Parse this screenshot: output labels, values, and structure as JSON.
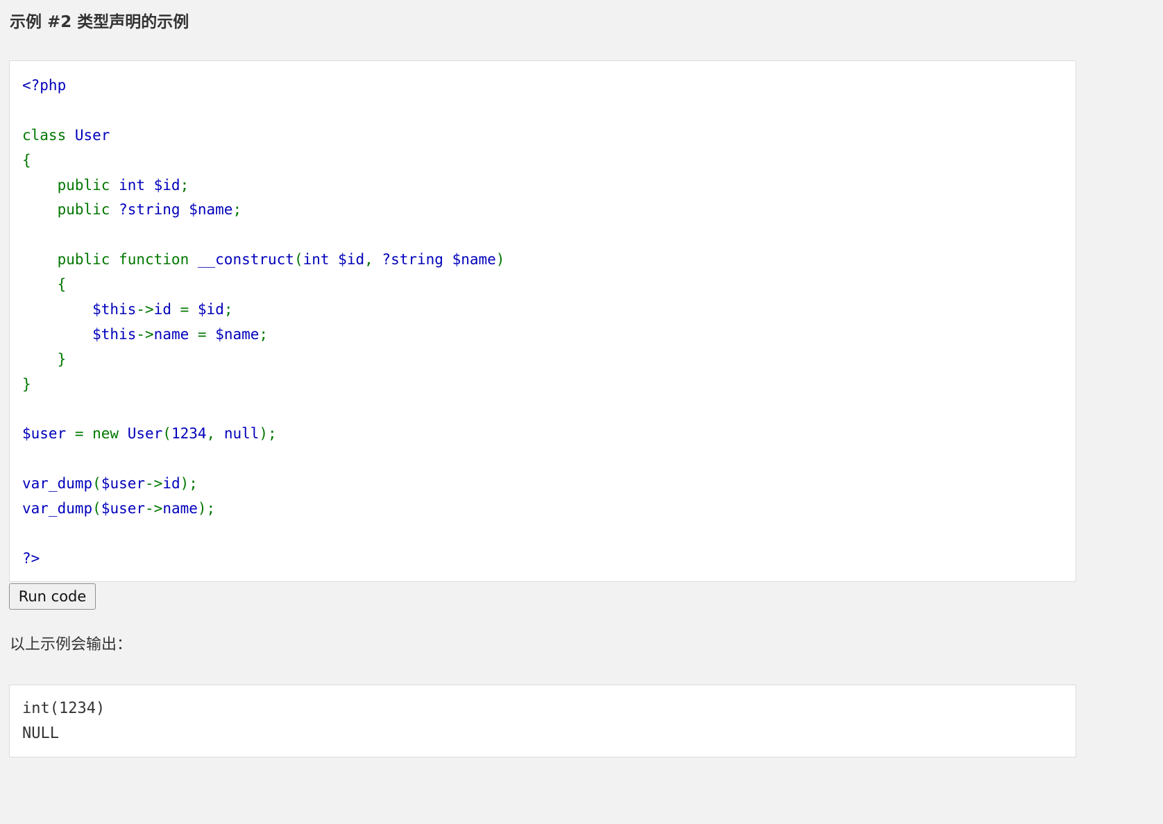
{
  "example": {
    "title": "示例 #2 类型声明的示例"
  },
  "code": {
    "lines": [
      [
        {
          "t": "<?php",
          "c": "d"
        }
      ],
      [],
      [
        {
          "t": "class ",
          "c": "k"
        },
        {
          "t": "User",
          "c": "d"
        }
      ],
      [
        {
          "t": "{",
          "c": "k"
        }
      ],
      [
        {
          "t": "    public ",
          "c": "k"
        },
        {
          "t": "int $id",
          "c": "d"
        },
        {
          "t": ";",
          "c": "k"
        }
      ],
      [
        {
          "t": "    public ",
          "c": "k"
        },
        {
          "t": "?string $name",
          "c": "d"
        },
        {
          "t": ";",
          "c": "k"
        }
      ],
      [],
      [
        {
          "t": "    public function ",
          "c": "k"
        },
        {
          "t": "__construct",
          "c": "d"
        },
        {
          "t": "(",
          "c": "k"
        },
        {
          "t": "int $id",
          "c": "d"
        },
        {
          "t": ", ",
          "c": "k"
        },
        {
          "t": "?string $name",
          "c": "d"
        },
        {
          "t": ")",
          "c": "k"
        }
      ],
      [
        {
          "t": "    {",
          "c": "k"
        }
      ],
      [
        {
          "t": "        $this",
          "c": "d"
        },
        {
          "t": "->",
          "c": "k"
        },
        {
          "t": "id ",
          "c": "d"
        },
        {
          "t": "= ",
          "c": "k"
        },
        {
          "t": "$id",
          "c": "d"
        },
        {
          "t": ";",
          "c": "k"
        }
      ],
      [
        {
          "t": "        $this",
          "c": "d"
        },
        {
          "t": "->",
          "c": "k"
        },
        {
          "t": "name ",
          "c": "d"
        },
        {
          "t": "= ",
          "c": "k"
        },
        {
          "t": "$name",
          "c": "d"
        },
        {
          "t": ";",
          "c": "k"
        }
      ],
      [
        {
          "t": "    }",
          "c": "k"
        }
      ],
      [
        {
          "t": "}",
          "c": "k"
        }
      ],
      [],
      [
        {
          "t": "$user ",
          "c": "d"
        },
        {
          "t": "= new ",
          "c": "k"
        },
        {
          "t": "User",
          "c": "d"
        },
        {
          "t": "(",
          "c": "k"
        },
        {
          "t": "1234",
          "c": "d"
        },
        {
          "t": ", ",
          "c": "k"
        },
        {
          "t": "null",
          "c": "d"
        },
        {
          "t": ");",
          "c": "k"
        }
      ],
      [],
      [
        {
          "t": "var_dump",
          "c": "d"
        },
        {
          "t": "(",
          "c": "k"
        },
        {
          "t": "$user",
          "c": "d"
        },
        {
          "t": "->",
          "c": "k"
        },
        {
          "t": "id",
          "c": "d"
        },
        {
          "t": ");",
          "c": "k"
        }
      ],
      [
        {
          "t": "var_dump",
          "c": "d"
        },
        {
          "t": "(",
          "c": "k"
        },
        {
          "t": "$user",
          "c": "d"
        },
        {
          "t": "->",
          "c": "k"
        },
        {
          "t": "name",
          "c": "d"
        },
        {
          "t": ");",
          "c": "k"
        }
      ],
      [],
      [
        {
          "t": "?>",
          "c": "d"
        }
      ]
    ]
  },
  "run_button": {
    "label": "Run code"
  },
  "output": {
    "intro": "以上示例会输出：",
    "lines": [
      "int(1234)",
      "NULL"
    ]
  },
  "colors": {
    "page_background": "#f2f2f2",
    "code_background": "#ffffff",
    "php_default_blue": "#0000bb",
    "php_keyword_green": "#007700",
    "text": "#333333"
  }
}
